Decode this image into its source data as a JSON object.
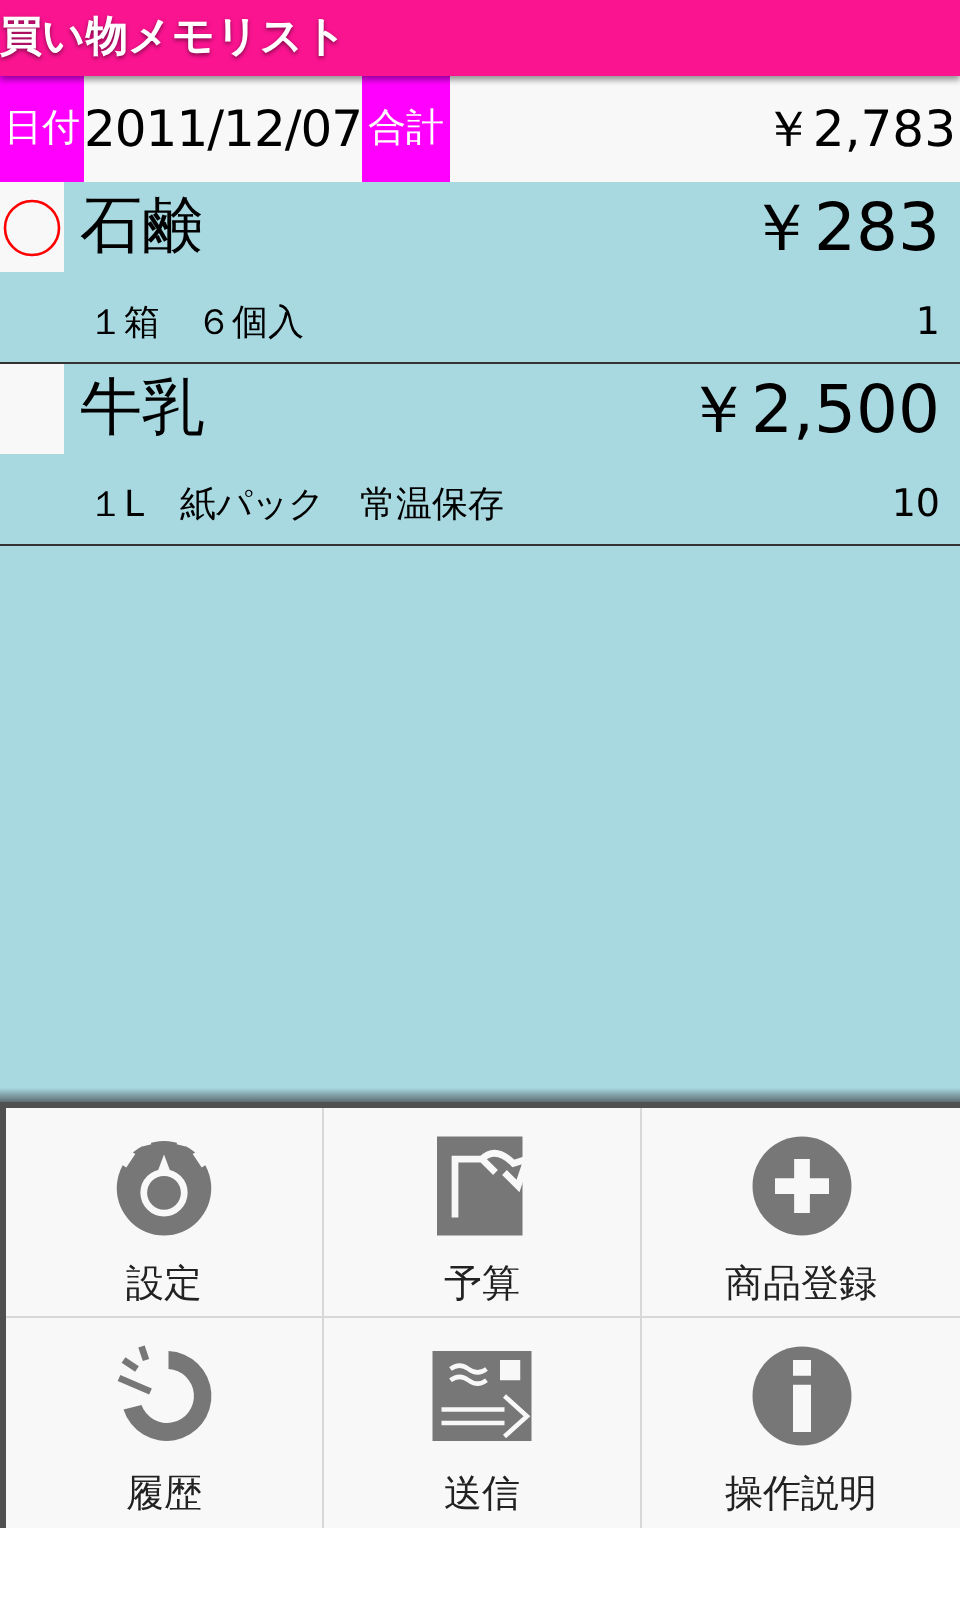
{
  "app_bar": {
    "title": "買い物メモリスト"
  },
  "summary": {
    "date_label": "日付",
    "date": "2011/12/07",
    "total_label": "合計",
    "total": "￥2,783"
  },
  "items": [
    {
      "name": "石鹸",
      "price": "￥283",
      "detail": "１箱　６個入",
      "quantity": "1",
      "marked": true
    },
    {
      "name": "牛乳",
      "price": "￥2,500",
      "detail": "１L　紙パック　常温保存",
      "quantity": "10",
      "marked": false
    }
  ],
  "menu": [
    {
      "label": "設定"
    },
    {
      "label": "予算"
    },
    {
      "label": "商品登録"
    },
    {
      "label": "履歴"
    },
    {
      "label": "送信"
    },
    {
      "label": "操作説明"
    }
  ]
}
